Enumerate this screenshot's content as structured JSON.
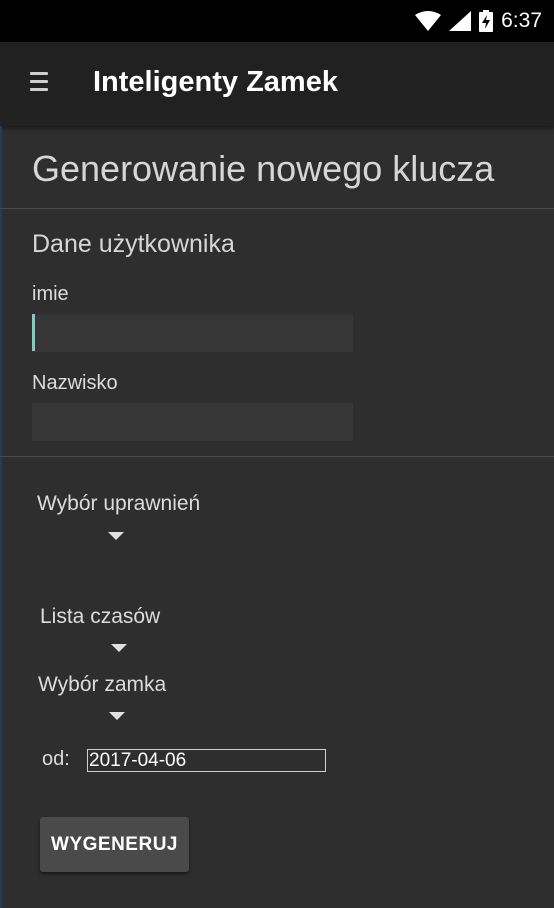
{
  "status_bar": {
    "time": "6:37",
    "icons": [
      "wifi-icon",
      "cell-signal-icon",
      "battery-charging-icon"
    ]
  },
  "app_bar": {
    "title": "Inteligenty Zamek",
    "menu_icon": "hamburger-menu-icon"
  },
  "page": {
    "title": "Generowanie nowego klucza",
    "user_section": "Dane użytkownika",
    "first_name_label": "imie",
    "first_name_value": "",
    "last_name_label": "Nazwisko",
    "last_name_value": ""
  },
  "spinners": {
    "permissions_label": "Wybór uprawnień",
    "times_label": "Lista czasów",
    "lock_label": "Wybór zamka"
  },
  "date": {
    "label": "od:",
    "value": "2017-04-06"
  },
  "actions": {
    "generate_label": "WYGENERUJ"
  },
  "colors": {
    "background": "#2e2e2e",
    "app_bar": "#212121",
    "accent": "#80cbc4",
    "status_bar": "#000000"
  }
}
